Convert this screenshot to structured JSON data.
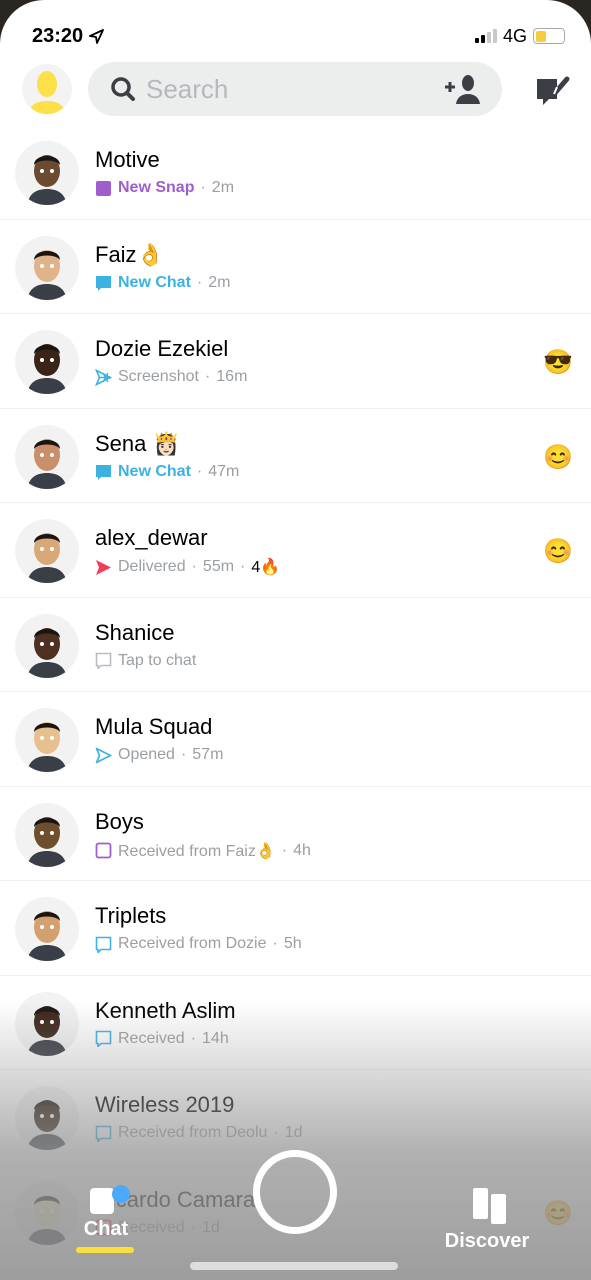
{
  "status_bar": {
    "time": "23:20",
    "network": "4G",
    "battery_percent": 40
  },
  "header": {
    "search_placeholder": "Search",
    "icons": [
      "bitmoji-avatar",
      "search-icon",
      "add-friend-icon",
      "new-chat-icon"
    ]
  },
  "colors": {
    "snap_purple": "#a05dcd",
    "chat_blue": "#3cb2e2",
    "delivered_red": "#f23c57",
    "accent_yellow": "#fffc00"
  },
  "chats": [
    {
      "name": "Motive",
      "icon": "snap-filled-purple",
      "status": "New Snap",
      "status_style": "purple-bold",
      "time": "2m",
      "emoji": ""
    },
    {
      "name": "Faiz👌",
      "icon": "chat-filled-blue",
      "status": "New Chat",
      "status_style": "blue-bold",
      "time": "2m",
      "emoji": ""
    },
    {
      "name": "Dozie Ezekiel",
      "icon": "screenshot-blue",
      "status": "Screenshot",
      "status_style": "grey",
      "time": "16m",
      "emoji": "😎"
    },
    {
      "name": "Sena 👸🏻",
      "icon": "chat-filled-blue",
      "status": "New Chat",
      "status_style": "blue-bold",
      "time": "47m",
      "emoji": "😊"
    },
    {
      "name": "alex_dewar",
      "icon": "arrow-filled-red",
      "status": "Delivered",
      "status_style": "grey",
      "time": "55m",
      "streak": "4🔥",
      "emoji": "😊"
    },
    {
      "name": "Shanice",
      "icon": "chat-outline-grey",
      "status": "Tap to chat",
      "status_style": "grey",
      "time": "",
      "emoji": ""
    },
    {
      "name": "Mula Squad",
      "icon": "arrow-outline-blue",
      "status": "Opened",
      "status_style": "grey",
      "time": "57m",
      "emoji": ""
    },
    {
      "name": "Boys",
      "icon": "snap-outline-purple",
      "status": "Received from Faiz👌",
      "status_style": "grey",
      "time": "4h",
      "emoji": ""
    },
    {
      "name": "Triplets",
      "icon": "chat-outline-blue",
      "status": "Received from Dozie",
      "status_style": "grey",
      "time": "5h",
      "emoji": ""
    },
    {
      "name": "Kenneth Aslim",
      "icon": "chat-outline-blue",
      "status": "Received",
      "status_style": "grey",
      "time": "14h",
      "emoji": ""
    },
    {
      "name": "Wireless 2019",
      "icon": "chat-outline-blue",
      "status": "Received from Deolu",
      "status_style": "grey",
      "time": "1d",
      "emoji": ""
    },
    {
      "name": "Ricardo Camara",
      "icon": "snap-outline-red",
      "status": "Received",
      "status_style": "grey",
      "time": "1d",
      "emoji": "😊"
    }
  ],
  "nav": {
    "chat_label": "Chat",
    "discover_label": "Discover",
    "chat_has_unread": true
  }
}
